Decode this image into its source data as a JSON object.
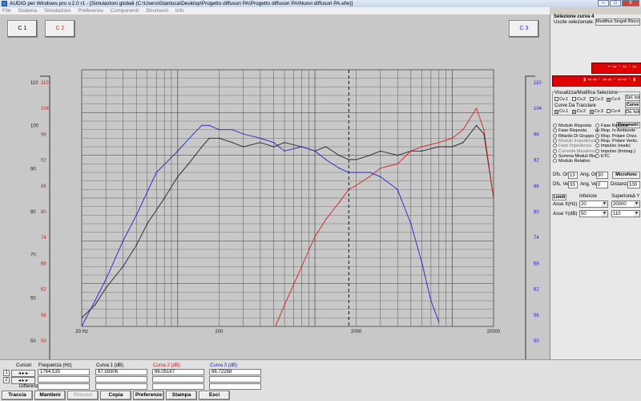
{
  "window": {
    "title": "AUDIO per Windows pro v.2.0 r1 - [Simulazioni globali (C:\\Users\\Gianluca\\Desktop\\Progetto diffusori PA\\Progetto diffusori PA\\Nuovi diffusori PA.efw)]",
    "buttons": [
      "–",
      "□",
      "X"
    ]
  },
  "menu": [
    "File",
    "Sistema",
    "Simulazioni",
    "Preferenze",
    "Componenti",
    "Strumenti",
    "Info"
  ],
  "curve_buttons": {
    "c1": "C 1",
    "c2": "C 2",
    "c3": "C 3"
  },
  "colors": {
    "curve1": "#222222",
    "curve2": "#d42020",
    "curve3": "#2222cc",
    "grid": "#555555"
  },
  "chart_data": {
    "type": "line",
    "x_scale": "log",
    "xlim": [
      20,
      20000
    ],
    "x_tick_labels": [
      "20 Hz",
      "200",
      "2000",
      "20000"
    ],
    "x_ticks": [
      20,
      200,
      2000,
      20000
    ],
    "cursor_x": 1764.535,
    "left_axis": {
      "ylim": [
        50,
        110
      ],
      "ticks": [
        "110",
        "100",
        "90",
        "80",
        "70",
        "60",
        "50"
      ]
    },
    "left_axis_red": {
      "ticks": [
        "110",
        "104",
        "98",
        "92",
        "86",
        "80",
        "74",
        "68",
        "62",
        "56",
        "50"
      ]
    },
    "right_axis": {
      "ylim": [
        50,
        110
      ],
      "ticks": [
        "110",
        "104",
        "98",
        "92",
        "86",
        "80",
        "74",
        "68",
        "62",
        "56",
        "50"
      ]
    },
    "grid": true,
    "series": [
      {
        "id": "curve1",
        "x": [
          20,
          25,
          30,
          40,
          50,
          60,
          80,
          100,
          120,
          150,
          170,
          200,
          250,
          300,
          400,
          500,
          600,
          800,
          1000,
          1200,
          1500,
          1764,
          2000,
          2500,
          3000,
          4000,
          5000,
          6000,
          8000,
          10000,
          12000,
          15000,
          17000,
          20000
        ],
        "y": [
          52,
          55,
          59,
          64,
          69,
          74,
          80,
          85,
          88,
          92,
          94,
          94,
          93,
          92,
          93,
          92,
          93,
          92,
          91,
          92,
          90,
          89,
          89,
          90,
          91,
          90,
          91,
          91,
          92,
          92,
          93,
          97,
          95,
          80
        ]
      },
      {
        "id": "curve2",
        "x": [
          300,
          350,
          400,
          500,
          600,
          800,
          1000,
          1200,
          1500,
          1764,
          2000,
          2500,
          3000,
          4000,
          5000,
          6000,
          8000,
          10000,
          12000,
          15000,
          17000,
          20000
        ],
        "y": [
          37,
          39,
          42,
          49,
          55,
          64,
          71,
          75,
          79,
          82,
          83,
          85,
          87,
          88,
          91,
          92,
          93,
          94,
          96,
          101,
          96,
          80
        ]
      },
      {
        "id": "curve3",
        "x": [
          20,
          25,
          30,
          40,
          50,
          70,
          100,
          130,
          150,
          170,
          200,
          250,
          300,
          400,
          500,
          600,
          800,
          1000,
          1200,
          1500,
          1764,
          2000,
          2500,
          3000,
          4000,
          5000,
          6000,
          7000,
          8000
        ],
        "y": [
          50,
          56,
          61,
          70,
          76,
          86,
          91,
          95,
          97,
          97,
          96,
          96,
          95,
          94,
          93,
          91,
          92,
          91,
          89,
          87,
          86,
          86,
          86,
          85,
          82,
          74,
          65,
          56,
          51
        ]
      }
    ]
  },
  "right_panel": {
    "selection_title": "Selezione curva 4",
    "selection_sub": "Uscite selezionate: 2",
    "single_blocks_btn": "Modifica Singoli Blocchi",
    "group_view_title": "Visualizza/Modifica Selezione",
    "view_checks": [
      "Cv.1",
      "Cv.2",
      "Cv.3",
      "Cv.4"
    ],
    "set_all": "Sel. tutto",
    "curve_label": "Curve",
    "trace_title": "Curve Da Tracciare",
    "trace_checks": [
      "Cv.1",
      "Cv.2",
      "Cv.3",
      "Cv.4"
    ],
    "deselect_all": "Ds. tutto",
    "params_label": "Parametri",
    "radios": [
      {
        "label": "Modulo Risposta",
        "sel": false,
        "dim": false
      },
      {
        "label": "Fase Relativa",
        "sel": false,
        "dim": false
      },
      {
        "label": "Fase Risposta",
        "sel": false,
        "dim": false
      },
      {
        "label": "Risp. In Ambiente",
        "sel": true,
        "dim": false
      },
      {
        "label": "Ritardo Di Gruppo",
        "sel": false,
        "dim": false
      },
      {
        "label": "Risp. Polare Orizz.",
        "sel": false,
        "dim": false
      },
      {
        "label": "Modulo Impedenza",
        "sel": false,
        "dim": true
      },
      {
        "label": "Risp. Polare Vertic.",
        "sel": false,
        "dim": false
      },
      {
        "label": "Fase Impedenza",
        "sel": false,
        "dim": true
      },
      {
        "label": "Impulso (reale)",
        "sel": false,
        "dim": false
      },
      {
        "label": "Corrente Massima",
        "sel": false,
        "dim": true
      },
      {
        "label": "Impulso (Immag.)",
        "sel": false,
        "dim": false
      },
      {
        "label": "Somma Moduli Risp.",
        "sel": false,
        "dim": false
      },
      {
        "label": "ETC",
        "sel": false,
        "dim": false
      },
      {
        "label": "Modulo Relativo",
        "sel": false,
        "dim": false
      }
    ],
    "dfs_or_label": "Dfs. Or.",
    "dfs_or": "13",
    "ang_or_label": "Ang. Or.",
    "ang_or": "30",
    "microfono": "Microfono",
    "dfs_ve_label": "Dfs. Ve.",
    "dfs_ve": "33",
    "ang_ve_label": "Ang. Ve.",
    "ang_ve": "0",
    "distanza_label": "Distanza",
    "distanza": "100",
    "limiti": "Limiti",
    "inferiore": "Inferiore",
    "superiore": "Superiore",
    "delta": "Δ Y",
    "asse_x": "Asse X",
    "hz": "(Hz)",
    "x_inf": "20",
    "x_sup": "20000",
    "asse_y": "Asse Y",
    "db": "(dB)",
    "y_inf": "50",
    "y_sup": "110"
  },
  "bottom": {
    "cursori": "Cursori",
    "differenza": "Differenza",
    "cursor_rows": [
      "1",
      "2"
    ],
    "freq_header": "Frequenza (Hz)",
    "freq_value": "1764.535",
    "c1_header": "Curva 1 (dB)",
    "c1_value": "87.59306",
    "c2_header": "Curva 2 (dB)",
    "c2_value": "86.05167",
    "c3_header": "Curva 3 (dB)",
    "c3_value": "86.72288"
  },
  "actions": [
    {
      "label": "Traccia",
      "disabled": false
    },
    {
      "label": "Mantieni",
      "disabled": false
    },
    {
      "label": "Rimuovi",
      "disabled": true
    },
    {
      "label": "Copia",
      "disabled": false
    },
    {
      "label": "Preferenze",
      "disabled": false
    },
    {
      "label": "Stampa",
      "disabled": false
    },
    {
      "label": "Esci",
      "disabled": false
    }
  ]
}
